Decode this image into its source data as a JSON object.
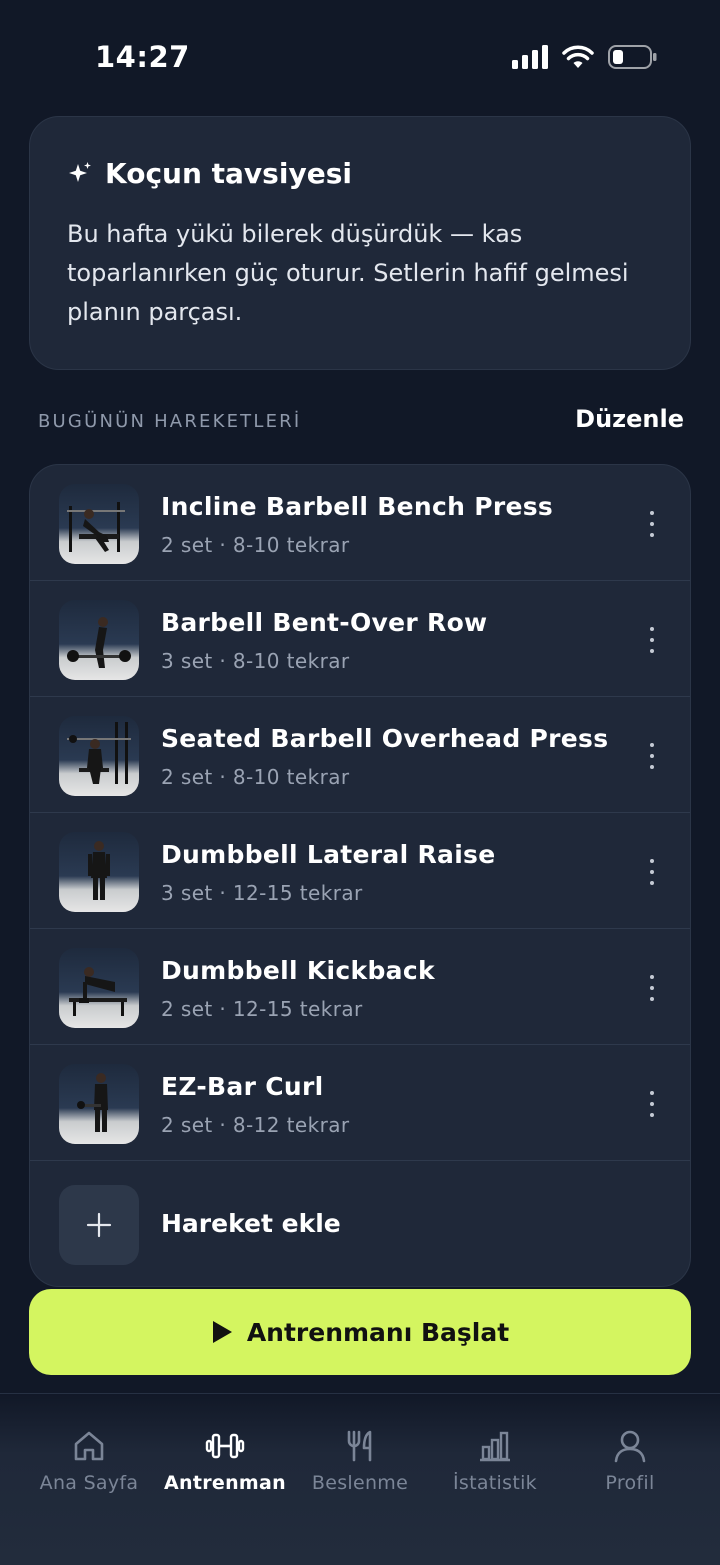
{
  "status_bar": {
    "time": "14:27"
  },
  "coach": {
    "title": "Koçun tavsiyesi",
    "body": "Bu hafta yükü bilerek düşürdük — kas toparlanırken güç oturur. Setlerin hafif gelmesi planın parçası."
  },
  "section": {
    "label": "BUGÜNÜN HAREKETLERİ",
    "action": "Düzenle"
  },
  "exercises": [
    {
      "name": "Incline Barbell Bench Press",
      "meta": "2 set · 8-10 tekrar"
    },
    {
      "name": "Barbell Bent-Over Row",
      "meta": "3 set · 8-10 tekrar"
    },
    {
      "name": "Seated Barbell Overhead Press",
      "meta": "2 set · 8-10 tekrar"
    },
    {
      "name": "Dumbbell Lateral Raise",
      "meta": "3 set · 12-15 tekrar"
    },
    {
      "name": "Dumbbell Kickback",
      "meta": "2 set · 12-15 tekrar"
    },
    {
      "name": "EZ-Bar Curl",
      "meta": "2 set · 8-12 tekrar"
    }
  ],
  "add_exercise": {
    "label": "Hareket ekle"
  },
  "start_button": {
    "label": "Antrenmanı Başlat"
  },
  "tabs": [
    {
      "label": "Ana Sayfa",
      "icon": "home-icon"
    },
    {
      "label": "Antrenman",
      "icon": "dumbbell-icon",
      "active": true
    },
    {
      "label": "Beslenme",
      "icon": "fork-knife-icon"
    },
    {
      "label": "İstatistik",
      "icon": "bar-chart-icon"
    },
    {
      "label": "Profil",
      "icon": "user-icon"
    }
  ],
  "colors": {
    "accent": "#d4f560",
    "background": "#111827",
    "card": "#1f2839"
  }
}
